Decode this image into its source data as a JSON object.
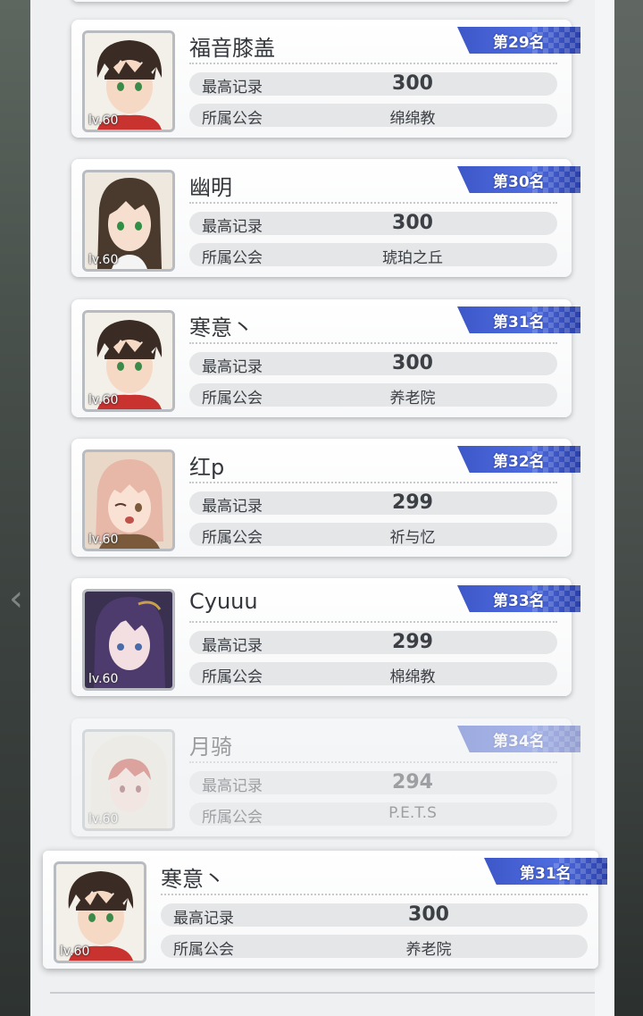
{
  "labels": {
    "best_record": "最高记录",
    "guild": "所属公会"
  },
  "entries": [
    {
      "name": "福音膝盖",
      "level": "lv.60",
      "rank": "第29名",
      "score": "300",
      "guild": "绵绵教",
      "avatar_icon": "boy-avatar-icon"
    },
    {
      "name": "幽明",
      "level": "lv.60",
      "rank": "第30名",
      "score": "300",
      "guild": "琥珀之丘",
      "avatar_icon": "girl-dark-hair-avatar-icon"
    },
    {
      "name": "寒意丶",
      "level": "lv.60",
      "rank": "第31名",
      "score": "300",
      "guild": "养老院",
      "avatar_icon": "boy-avatar-icon"
    },
    {
      "name": "红p",
      "level": "lv.60",
      "rank": "第32名",
      "score": "299",
      "guild": "祈与忆",
      "avatar_icon": "pink-hair-girl-avatar-icon"
    },
    {
      "name": "Cyuuu",
      "level": "lv.60",
      "rank": "第33名",
      "score": "299",
      "guild": "棉绵教",
      "avatar_icon": "purple-hair-girl-avatar-icon"
    },
    {
      "name": "月骑",
      "level": "lv.60",
      "rank": "第34名",
      "score": "294",
      "guild": "P.E.T.S",
      "avatar_icon": "red-hair-hooded-avatar-icon"
    }
  ],
  "self": {
    "name": "寒意丶",
    "level": "lv.60",
    "rank": "第31名",
    "score": "300",
    "guild": "养老院",
    "avatar_icon": "boy-avatar-icon"
  }
}
